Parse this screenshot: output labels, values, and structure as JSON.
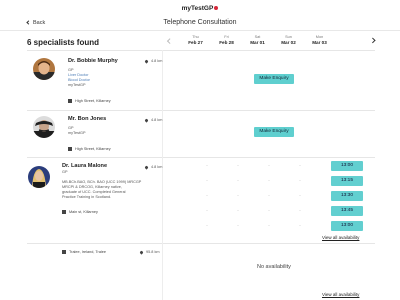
{
  "header": {
    "logo_text": "myTestGP",
    "back_label": "Back",
    "page_title": "Telephone Consultation"
  },
  "results": {
    "count_label": "6 specialists found"
  },
  "days": [
    {
      "name": "Thu",
      "date": "Feb 27"
    },
    {
      "name": "Fri",
      "date": "Feb 28"
    },
    {
      "name": "Sat",
      "date": "Mar 01"
    },
    {
      "name": "Sun",
      "date": "Mar 02"
    },
    {
      "name": "Mon",
      "date": "Mar 03"
    }
  ],
  "specialists": [
    {
      "name": "Dr. Bobbie Murphy",
      "distance": "4.8 km",
      "role": "GP",
      "details": [
        "Liver Doctor",
        "Blood Doctor"
      ],
      "clinic": "myTestGP",
      "address": "High Street, Killarney",
      "action": "Make Enquiry"
    },
    {
      "name": "Mr. Bon Jones",
      "distance": "4.8 km",
      "role": "GP",
      "clinic": "myTestGP",
      "address": "High Street, Killarney",
      "action": "Make Enquiry"
    },
    {
      "name": "Dr. Laura Malone",
      "distance": "4.8 km",
      "role": "GP",
      "bio": [
        "MB.BCh.BAO, BCh. BAO (UCC 1999) MRCGP",
        "MRCPI & DRCOG, Killarney native,",
        "graduate of UCC. Completed General",
        "Practice Training in Scotland."
      ],
      "address": "Main st, Killarney",
      "slots": [
        "13:00",
        "13:15",
        "13:30",
        "13:45",
        "13:00"
      ],
      "dash": "-",
      "view_all": "View all availability"
    },
    {
      "address": "Tralee, Ireland, Tralee",
      "distance": "95.8 km",
      "no_availability": "No availability",
      "view_all": "View all availability"
    }
  ],
  "colors": {
    "accent": "#5fcfcf",
    "logo_dot": "#d6283a"
  }
}
